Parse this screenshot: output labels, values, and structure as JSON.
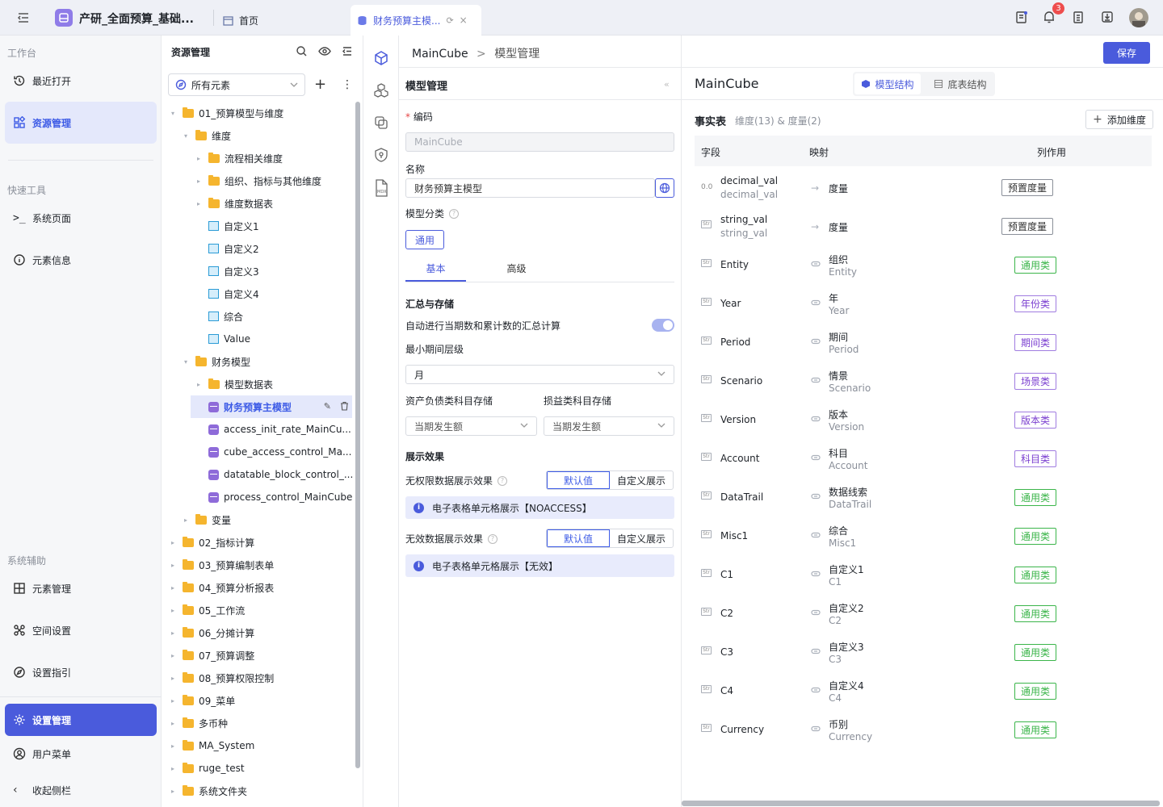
{
  "topbar": {
    "app_title": "产研_全面预算_基础...",
    "tab_home": "首页",
    "tab_active": "财务预算主模...",
    "notif_count": "3"
  },
  "leftnav": {
    "sec1": "工作台",
    "recent": "最近打开",
    "resource": "资源管理",
    "sec2": "快速工具",
    "syspage": "系统页面",
    "eleminfo": "元素信息",
    "sec3": "系统辅助",
    "elemmgr": "元素管理",
    "space": "空间设置",
    "guide": "设置指引",
    "settings": "设置管理",
    "usermenu": "用户菜单",
    "collapse": "收起侧栏"
  },
  "resource": {
    "title": "资源管理",
    "filter": "所有元素",
    "tree": [
      {
        "label": "01_预算模型与维度",
        "level": 0,
        "type": "folder",
        "open": true
      },
      {
        "label": "维度",
        "level": 1,
        "type": "folder",
        "open": true
      },
      {
        "label": "流程相关维度",
        "level": 2,
        "type": "folder"
      },
      {
        "label": "组织、指标与其他维度",
        "level": 2,
        "type": "folder"
      },
      {
        "label": "维度数据表",
        "level": 2,
        "type": "folder"
      },
      {
        "label": "自定义1",
        "level": 2,
        "type": "table",
        "leaf": true
      },
      {
        "label": "自定义2",
        "level": 2,
        "type": "table",
        "leaf": true
      },
      {
        "label": "自定义3",
        "level": 2,
        "type": "table",
        "leaf": true
      },
      {
        "label": "自定义4",
        "level": 2,
        "type": "table",
        "leaf": true
      },
      {
        "label": "综合",
        "level": 2,
        "type": "table",
        "leaf": true
      },
      {
        "label": "Value",
        "level": 2,
        "type": "table",
        "leaf": true
      },
      {
        "label": "财务模型",
        "level": 1,
        "type": "folder",
        "open": true
      },
      {
        "label": "模型数据表",
        "level": 2,
        "type": "folder"
      },
      {
        "label": "财务预算主模型",
        "level": 2,
        "type": "db",
        "leaf": true,
        "selected": true
      },
      {
        "label": "access_init_rate_MainCu...",
        "level": 2,
        "type": "db",
        "leaf": true
      },
      {
        "label": "cube_access_control_Ma...",
        "level": 2,
        "type": "db",
        "leaf": true
      },
      {
        "label": "datatable_block_control_...",
        "level": 2,
        "type": "db",
        "leaf": true
      },
      {
        "label": "process_control_MainCube",
        "level": 2,
        "type": "db",
        "leaf": true
      },
      {
        "label": "变量",
        "level": 1,
        "type": "folder"
      },
      {
        "label": "02_指标计算",
        "level": 0,
        "type": "folder"
      },
      {
        "label": "03_预算编制表单",
        "level": 0,
        "type": "folder"
      },
      {
        "label": "04_预算分析报表",
        "level": 0,
        "type": "folder"
      },
      {
        "label": "05_工作流",
        "level": 0,
        "type": "folder"
      },
      {
        "label": "06_分摊计算",
        "level": 0,
        "type": "folder"
      },
      {
        "label": "07_预算调整",
        "level": 0,
        "type": "folder"
      },
      {
        "label": "08_预算权限控制",
        "level": 0,
        "type": "folder"
      },
      {
        "label": "09_菜单",
        "level": 0,
        "type": "folder"
      },
      {
        "label": "多币种",
        "level": 0,
        "type": "folder"
      },
      {
        "label": "MA_System",
        "level": 0,
        "type": "folder"
      },
      {
        "label": "ruge_test",
        "level": 0,
        "type": "folder"
      },
      {
        "label": "系统文件夹",
        "level": 0,
        "type": "folder"
      }
    ]
  },
  "breadcrumb": {
    "root": "MainCube",
    "sep": ">",
    "current": "模型管理"
  },
  "save_label": "保存",
  "form": {
    "title": "模型管理",
    "code_label": "编码",
    "code_value": "MainCube",
    "name_label": "名称",
    "name_value": "财务预算主模型",
    "category_label": "模型分类",
    "category_value": "通用",
    "tab_basic": "基本",
    "tab_adv": "高级",
    "sum_title": "汇总与存储",
    "auto_sum": "自动进行当期数和累计数的汇总计算",
    "min_period_label": "最小期间层级",
    "min_period": "月",
    "bs_label": "资产负债类科目存储",
    "bs_value": "当期发生额",
    "pl_label": "损益类科目存储",
    "pl_value": "当期发生额",
    "display_title": "展示效果",
    "noperm_label": "无权限数据展示效果",
    "invalid_label": "无效数据展示效果",
    "seg_default": "默认值",
    "seg_custom": "自定义展示",
    "noperm_info": "电子表格单元格展示【NOACCESS】",
    "invalid_info": "电子表格单元格展示【无效】"
  },
  "right": {
    "title": "MainCube",
    "tab_model": "模型结构",
    "tab_table": "底表结构",
    "fact": "事实表",
    "fact_sub": "维度(13) & 度量(2)",
    "add_dim": "添加维度",
    "col_field": "字段",
    "col_map": "映射",
    "col_role": "列作用",
    "rows": [
      {
        "name": "decimal_val",
        "sub": "decimal_val",
        "icon": "0.0",
        "map": "度量",
        "map_sub": "",
        "tag": "预置度量",
        "kind": "measure"
      },
      {
        "name": "string_val",
        "sub": "string_val",
        "icon": "Str",
        "map": "度量",
        "map_sub": "",
        "tag": "预置度量",
        "kind": "measure"
      },
      {
        "name": "Entity",
        "sub": "",
        "icon": "Str",
        "map": "组织",
        "map_sub": "Entity",
        "tag": "通用类",
        "kind": "green"
      },
      {
        "name": "Year",
        "sub": "",
        "icon": "Str",
        "map": "年",
        "map_sub": "Year",
        "tag": "年份类",
        "kind": "purple"
      },
      {
        "name": "Period",
        "sub": "",
        "icon": "Str",
        "map": "期间",
        "map_sub": "Period",
        "tag": "期间类",
        "kind": "purple"
      },
      {
        "name": "Scenario",
        "sub": "",
        "icon": "Str",
        "map": "情景",
        "map_sub": "Scenario",
        "tag": "场景类",
        "kind": "purple"
      },
      {
        "name": "Version",
        "sub": "",
        "icon": "Str",
        "map": "版本",
        "map_sub": "Version",
        "tag": "版本类",
        "kind": "purple"
      },
      {
        "name": "Account",
        "sub": "",
        "icon": "Str",
        "map": "科目",
        "map_sub": "Account",
        "tag": "科目类",
        "kind": "purple"
      },
      {
        "name": "DataTrail",
        "sub": "",
        "icon": "Str",
        "map": "数据线索",
        "map_sub": "DataTrail",
        "tag": "通用类",
        "kind": "green"
      },
      {
        "name": "Misc1",
        "sub": "",
        "icon": "Str",
        "map": "综合",
        "map_sub": "Misc1",
        "tag": "通用类",
        "kind": "green"
      },
      {
        "name": "C1",
        "sub": "",
        "icon": "Str",
        "map": "自定义1",
        "map_sub": "C1",
        "tag": "通用类",
        "kind": "green"
      },
      {
        "name": "C2",
        "sub": "",
        "icon": "Str",
        "map": "自定义2",
        "map_sub": "C2",
        "tag": "通用类",
        "kind": "green"
      },
      {
        "name": "C3",
        "sub": "",
        "icon": "Str",
        "map": "自定义3",
        "map_sub": "C3",
        "tag": "通用类",
        "kind": "green"
      },
      {
        "name": "C4",
        "sub": "",
        "icon": "Str",
        "map": "自定义4",
        "map_sub": "C4",
        "tag": "通用类",
        "kind": "green"
      },
      {
        "name": "Currency",
        "sub": "",
        "icon": "Str",
        "map": "币别",
        "map_sub": "Currency",
        "tag": "通用类",
        "kind": "green"
      }
    ]
  },
  "colors": {
    "accent": "#4a5bdc",
    "green": "#3bb54a",
    "purple": "#7b3fd0"
  }
}
